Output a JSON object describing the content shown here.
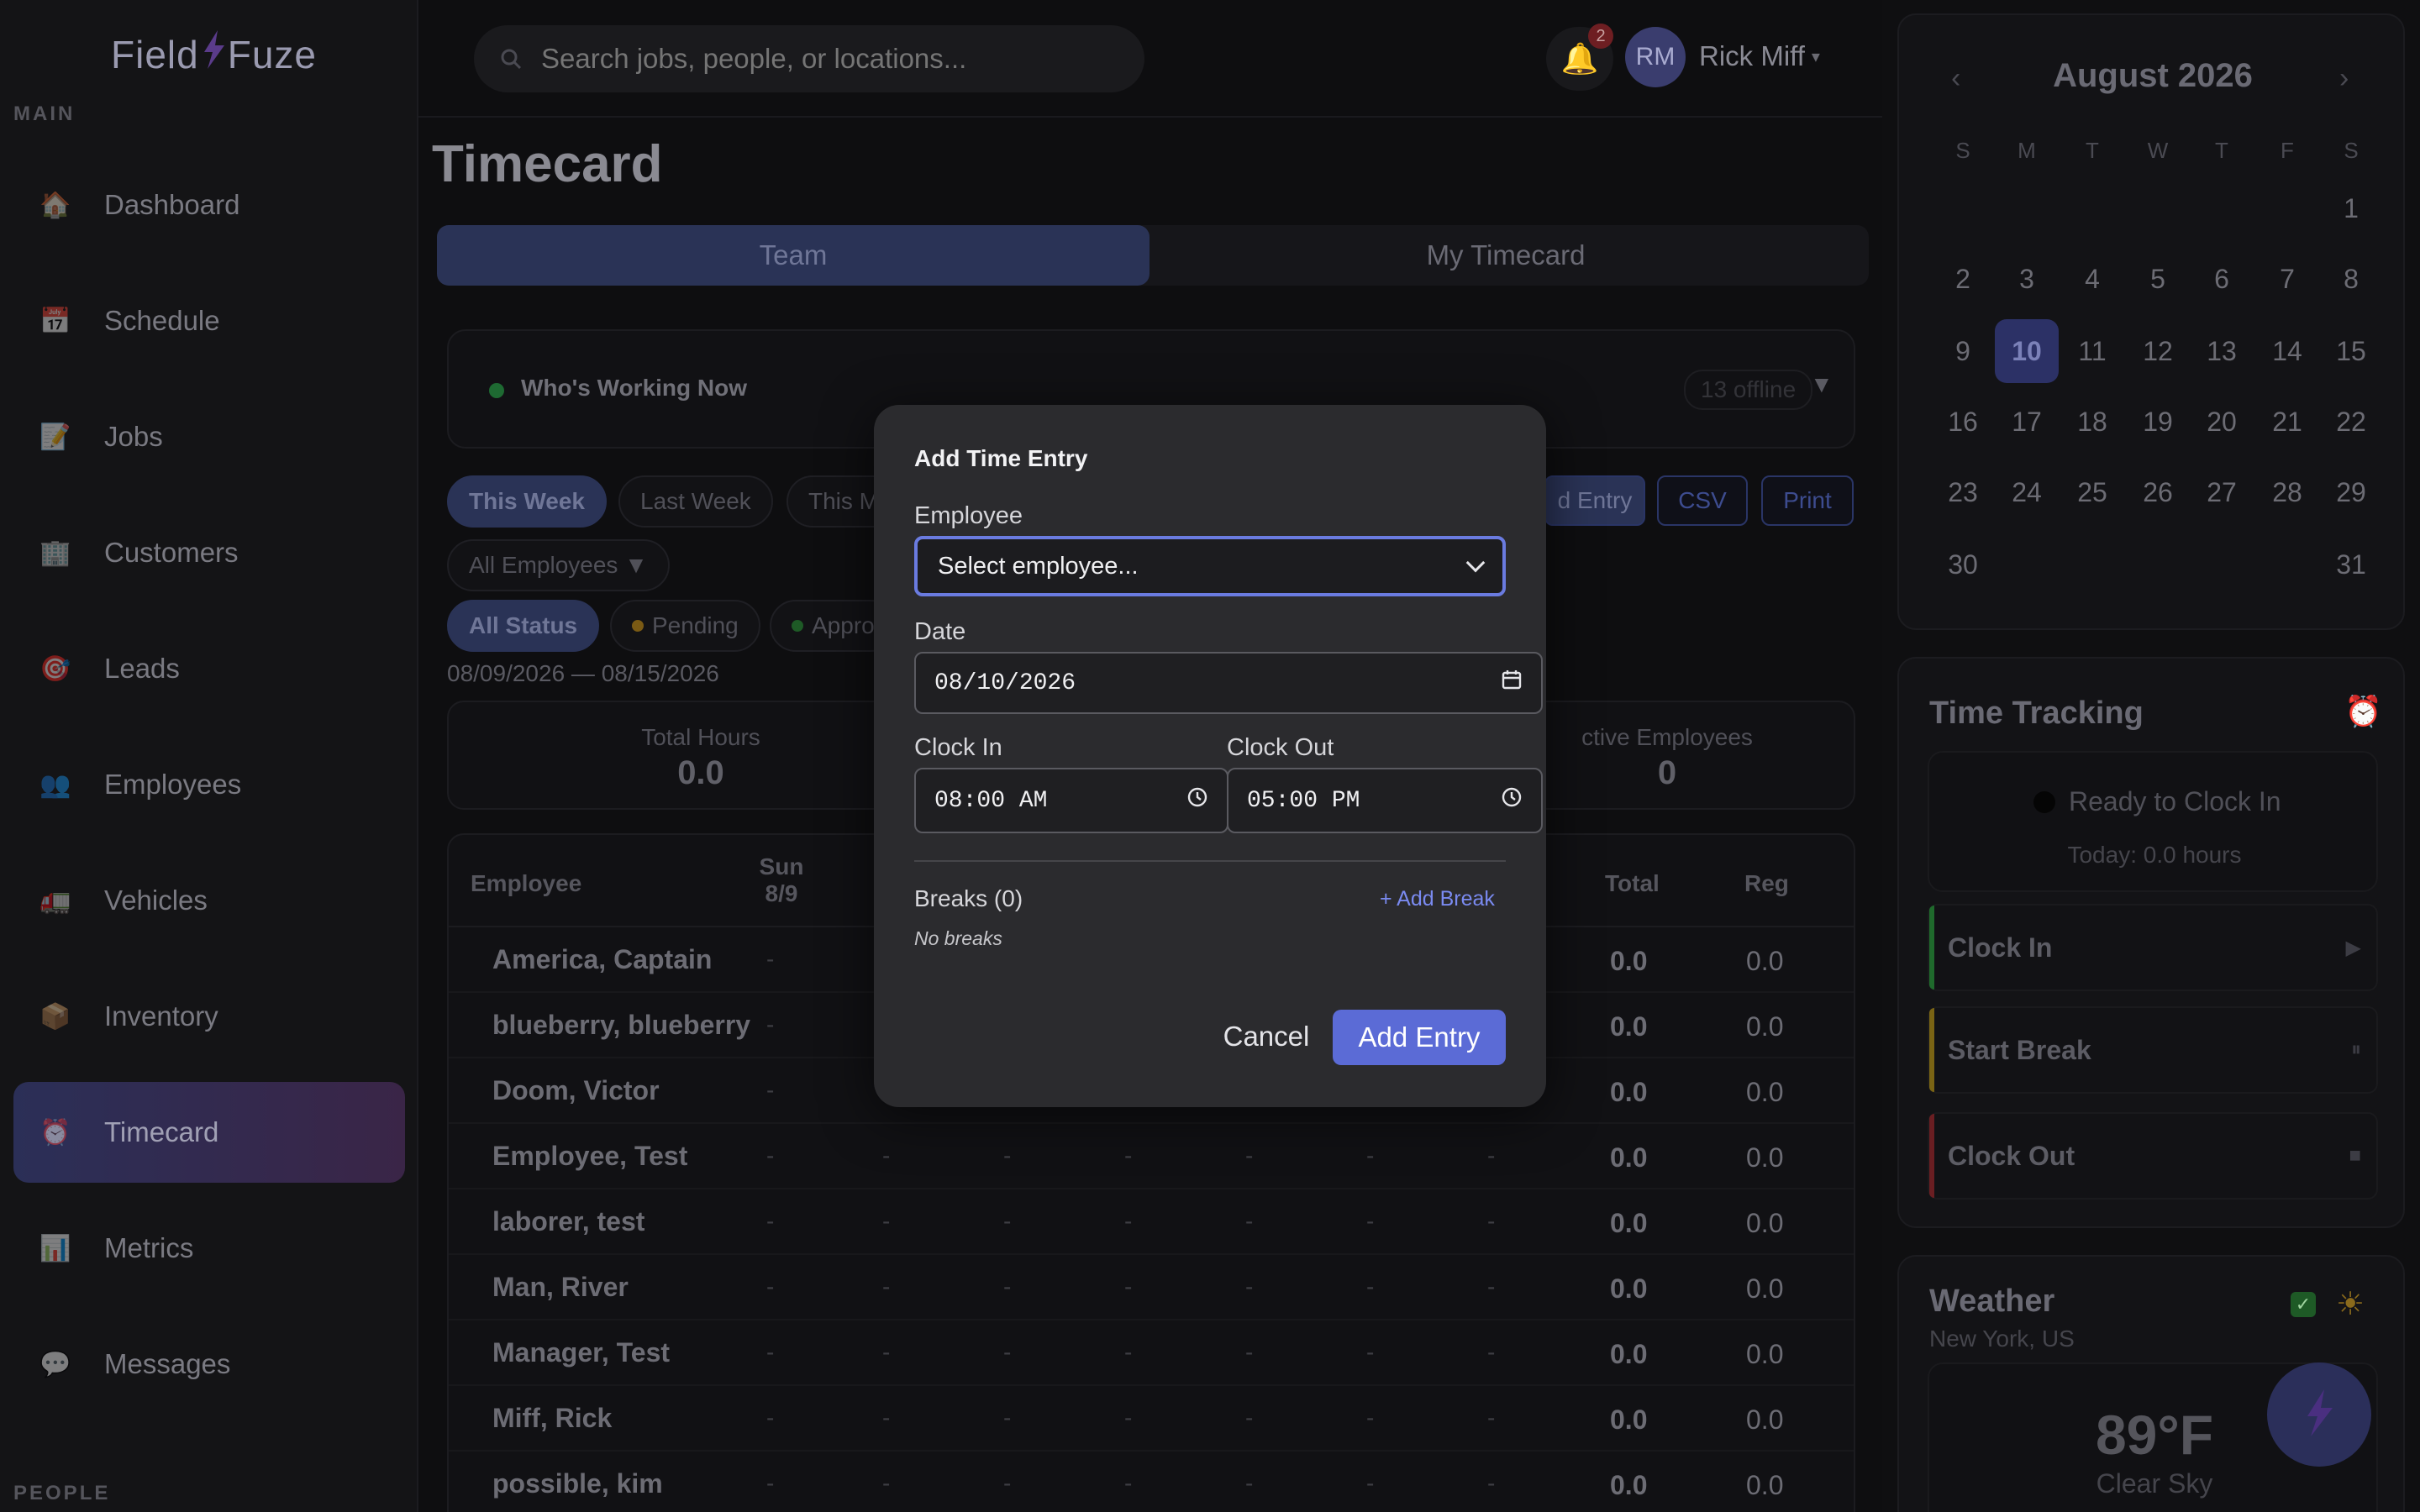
{
  "app": {
    "logo_left": "Field",
    "logo_right": "Fuze"
  },
  "sidebar": {
    "section_main": "MAIN",
    "section_people": "PEOPLE",
    "items": [
      {
        "label": "Dashboard",
        "icon": "house-icon"
      },
      {
        "label": "Schedule",
        "icon": "calendar-icon"
      },
      {
        "label": "Jobs",
        "icon": "memo-icon"
      },
      {
        "label": "Customers",
        "icon": "building-icon"
      },
      {
        "label": "Leads",
        "icon": "target-icon"
      },
      {
        "label": "Employees",
        "icon": "people-icon"
      },
      {
        "label": "Vehicles",
        "icon": "truck-icon"
      },
      {
        "label": "Inventory",
        "icon": "box-icon"
      },
      {
        "label": "Timecard",
        "icon": "alarm-clock-icon"
      },
      {
        "label": "Metrics",
        "icon": "bar-chart-icon"
      },
      {
        "label": "Messages",
        "icon": "speech-bubble-icon"
      }
    ],
    "active": "Timecard"
  },
  "header": {
    "search_placeholder": "Search jobs, people, or locations...",
    "notification_count": "2",
    "avatar_initials": "RM",
    "user_name": "Rick Miff",
    "user_caret": "▾"
  },
  "main": {
    "title": "Timecard",
    "tabs": [
      "Team",
      "My Timecard"
    ],
    "active_tab": "Team",
    "who_working": "Who's Working Now",
    "offline_count": "13 offline",
    "who_chevron": "▼",
    "period_chips": [
      "This Week",
      "Last Week",
      "This M"
    ],
    "actions": {
      "add_entry": "d Entry",
      "csv": "CSV",
      "print": "Print"
    },
    "employee_filter": "All Employees ▼",
    "status_chips": [
      "All Status",
      "Pending",
      "Appro"
    ],
    "date_range": "08/09/2026 — 08/15/2026",
    "stats": [
      {
        "label": "Total Hours",
        "value": "0.0"
      },
      {
        "label": "ctive Employees",
        "value": "0"
      }
    ],
    "table": {
      "headers": {
        "employee": "Employee",
        "sun": "Sun",
        "sun_date": "8/9",
        "total": "Total",
        "reg": "Reg"
      },
      "dash": "-",
      "rows": [
        {
          "name": "America, Captain",
          "total": "0.0",
          "reg": "0.0"
        },
        {
          "name": "blueberry, blueberry",
          "total": "0.0",
          "reg": "0.0"
        },
        {
          "name": "Doom, Victor",
          "total": "0.0",
          "reg": "0.0"
        },
        {
          "name": "Employee, Test",
          "total": "0.0",
          "reg": "0.0"
        },
        {
          "name": "laborer, test",
          "total": "0.0",
          "reg": "0.0"
        },
        {
          "name": "Man, River",
          "total": "0.0",
          "reg": "0.0"
        },
        {
          "name": "Manager, Test",
          "total": "0.0",
          "reg": "0.0"
        },
        {
          "name": "Miff, Rick",
          "total": "0.0",
          "reg": "0.0"
        },
        {
          "name": "possible, kim",
          "total": "0.0",
          "reg": "0.0"
        }
      ]
    }
  },
  "calendar": {
    "month": "August 2026",
    "prev": "‹",
    "next": "›",
    "dow": [
      "S",
      "M",
      "T",
      "W",
      "T",
      "F",
      "S"
    ],
    "selected": "10"
  },
  "time_tracking": {
    "title": "Time Tracking",
    "status": "Ready to Clock In",
    "today": "Today: 0.0 hours",
    "actions": [
      {
        "label": "Clock In",
        "icon": "▶",
        "color": "#1f6a2c"
      },
      {
        "label": "Start Break",
        "icon": "⏸",
        "color": "#7a6414"
      },
      {
        "label": "Clock Out",
        "icon": "■",
        "color": "#6a1e22"
      }
    ]
  },
  "weather": {
    "title": "Weather",
    "location": "New York, US",
    "check": "✓",
    "temp": "89°F",
    "condition": "Clear Sky"
  },
  "modal": {
    "title": "Add Time Entry",
    "employee_label": "Employee",
    "employee_value": "Select employee...",
    "date_label": "Date",
    "date_value": "08/10/2026",
    "clock_in_label": "Clock In",
    "clock_in_value": "08:00 AM",
    "clock_out_label": "Clock Out",
    "clock_out_value": "05:00 PM",
    "breaks_label": "Breaks (0)",
    "add_break": "+ Add Break",
    "no_breaks": "No breaks",
    "cancel": "Cancel",
    "submit": "Add Entry"
  },
  "colors": {
    "accent": "#5b6bd6",
    "focus_ring": "#6a7be0",
    "modal_bg": "#2b2b2e",
    "selected_day": "#2c3166"
  }
}
